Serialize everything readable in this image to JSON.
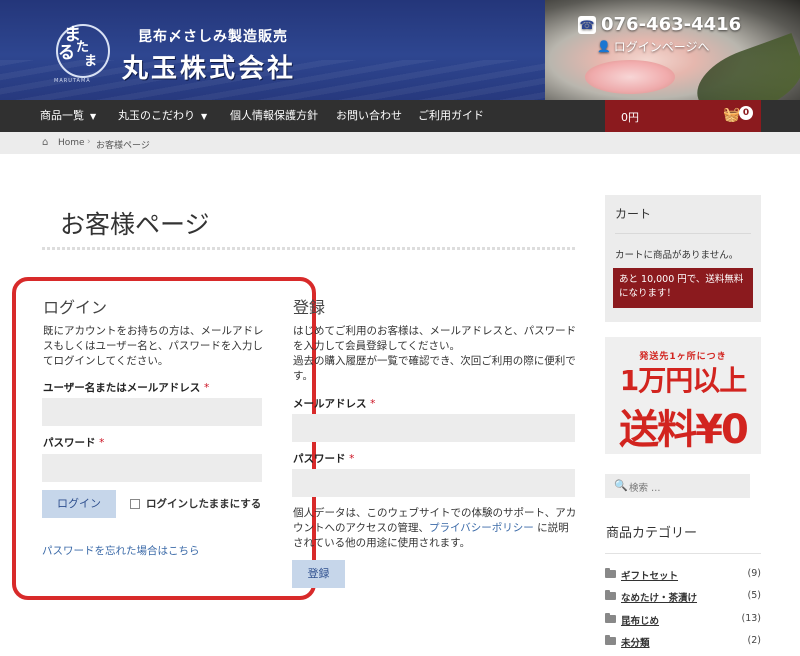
{
  "header": {
    "emblem_chars": [
      "ま",
      "る",
      "た",
      "ま"
    ],
    "emblem_sub": "MARUTAMA",
    "tagline": "昆布〆さしみ製造販売",
    "company": "丸玉株式会社",
    "phone": "076-463-4416",
    "login_link": "ログインページへ"
  },
  "nav": {
    "items": [
      {
        "label": "商品一覧",
        "has_caret": true
      },
      {
        "label": "丸玉のこだわり",
        "has_caret": true
      },
      {
        "label": "個人情報保護方針",
        "has_caret": false
      },
      {
        "label": "お問い合わせ",
        "has_caret": false
      },
      {
        "label": "ご利用ガイド",
        "has_caret": false
      }
    ],
    "cart_total": "0円",
    "cart_count": "0"
  },
  "breadcrumb": {
    "home": "Home",
    "current": "お客様ページ"
  },
  "page_title": "お客様ページ",
  "login": {
    "title": "ログイン",
    "intro": "既にアカウントをお持ちの方は、メールアドレスもしくはユーザー名と、パスワードを入力してログインしてください。",
    "username_label": "ユーザー名またはメールアドレス",
    "password_label": "パスワード",
    "required_mark": "*",
    "submit_label": "ログイン",
    "remember_label": "ログインしたままにする",
    "lost_password": "パスワードを忘れた場合はこちら"
  },
  "register": {
    "title": "登録",
    "intro1": "はじめてご利用のお客様は、メールアドレスと、パスワードを入力して会員登録してください。",
    "intro2": "過去の購入履歴が一覧で確認でき、次回ご利用の際に便利です。",
    "email_label": "メールアドレス",
    "password_label": "パスワード",
    "privacy_text_before": "個人データは、このウェブサイトでの体験のサポート、アカウントへのアクセスの管理、",
    "privacy_link": "プライバシーポリシー",
    "privacy_text_after": "に説明されている他の用途に使用されます。",
    "submit_label": "登録"
  },
  "sidebar": {
    "cart_title": "カート",
    "cart_empty": "カートに商品がありません。",
    "shipping_notice": "あと 10,000 円で、送料無料になります！",
    "banner_small": "発送先1ヶ所につき",
    "banner_line1": "1万円以上",
    "banner_line2": "送料¥0",
    "search_placeholder": "検索 …",
    "categories_title": "商品カテゴリー",
    "categories": [
      {
        "name": "ギフトセット",
        "count": "(9)"
      },
      {
        "name": "なめたけ・茶漬け",
        "count": "(5)"
      },
      {
        "name": "昆布じめ",
        "count": "(13)"
      },
      {
        "name": "未分類",
        "count": "(2)"
      }
    ]
  },
  "colors": {
    "header_blue": "#2e4690",
    "nav_dark": "#303030",
    "cart_red": "#8b1a1e",
    "highlight_red": "#d82a2a",
    "link_blue": "#3b6aa8"
  }
}
